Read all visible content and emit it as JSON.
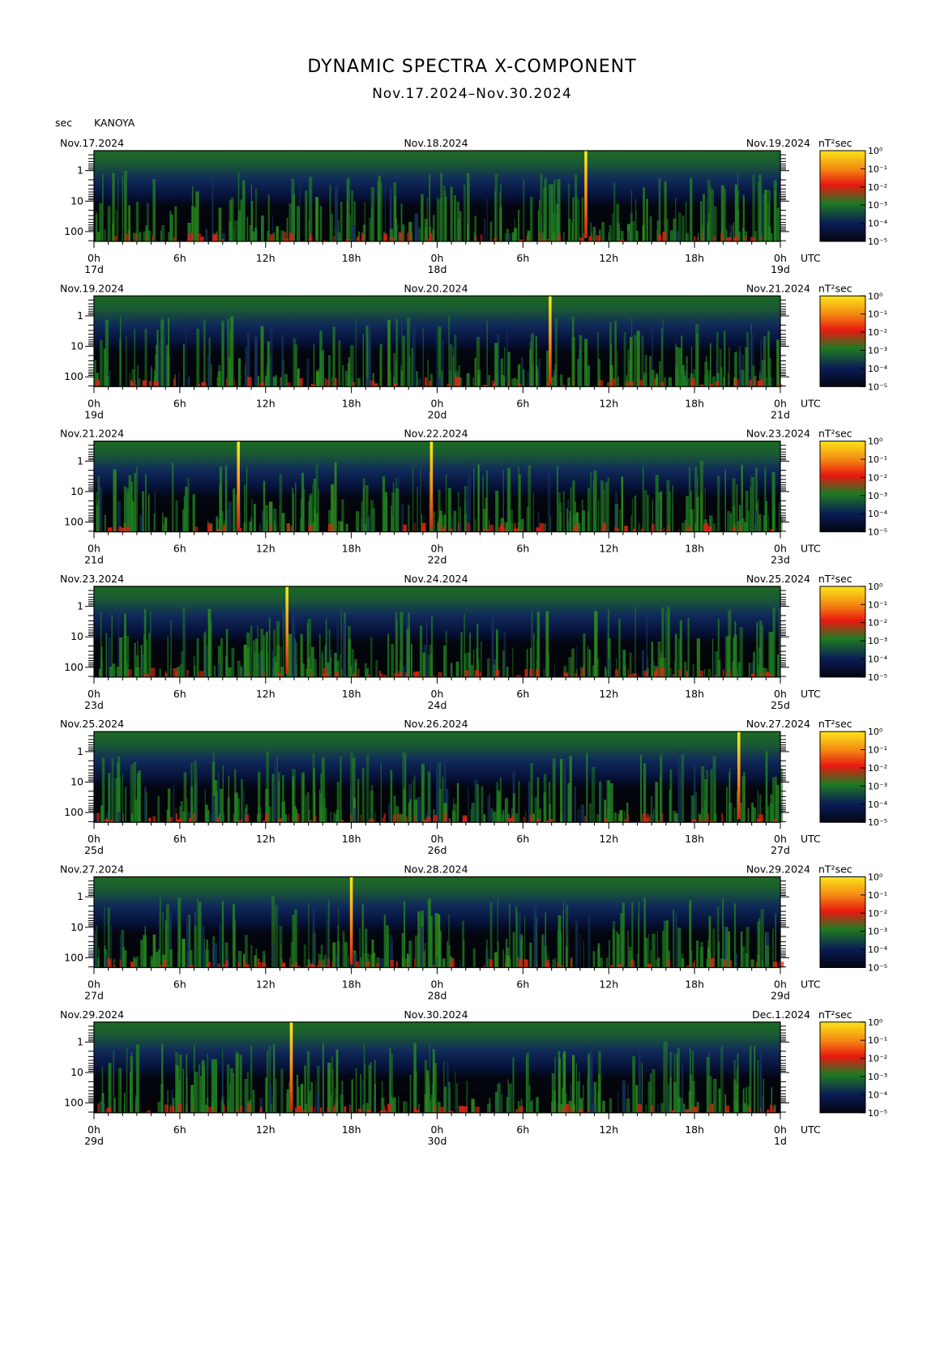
{
  "header": {
    "title": "DYNAMIC SPECTRA X-COMPONENT",
    "subtitle": "Nov.17.2024–Nov.30.2024",
    "unit_left": "sec",
    "station": "KANOYA"
  },
  "chart_data": {
    "type": "heatmap",
    "ylabel": "sec",
    "y_scale": "log",
    "y_tick_labels": [
      "1",
      "10",
      "100"
    ],
    "x_tick_labels": [
      "0h",
      "6h",
      "12h",
      "18h",
      "0h",
      "6h",
      "12h",
      "18h",
      "0h"
    ],
    "x_unit": "UTC",
    "colorbar_unit": "nT²sec",
    "colorbar_ticks": [
      "10⁰",
      "10⁻¹",
      "10⁻²",
      "10⁻³",
      "10⁻⁴",
      "10⁻⁵"
    ],
    "colormap": [
      "#050510",
      "#0a1c56",
      "#1e7a22",
      "#e81810",
      "#fbe51a"
    ],
    "panels": [
      {
        "date_left": "Nov.17.2024",
        "date_mid": "Nov.18.2024",
        "date_right": "Nov.19.2024",
        "day_left": "17d",
        "day_mid": "18d",
        "day_right": "19d",
        "spikes_hours": [
          34.4
        ]
      },
      {
        "date_left": "Nov.19.2024",
        "date_mid": "Nov.20.2024",
        "date_right": "Nov.21.2024",
        "day_left": "19d",
        "day_mid": "20d",
        "day_right": "21d",
        "spikes_hours": [
          31.9
        ]
      },
      {
        "date_left": "Nov.21.2024",
        "date_mid": "Nov.22.2024",
        "date_right": "Nov.23.2024",
        "day_left": "21d",
        "day_mid": "22d",
        "day_right": "23d",
        "spikes_hours": [
          10.1,
          23.6
        ]
      },
      {
        "date_left": "Nov.23.2024",
        "date_mid": "Nov.24.2024",
        "date_right": "Nov.25.2024",
        "day_left": "23d",
        "day_mid": "24d",
        "day_right": "25d",
        "spikes_hours": [
          13.5
        ]
      },
      {
        "date_left": "Nov.25.2024",
        "date_mid": "Nov.26.2024",
        "date_right": "Nov.27.2024",
        "day_left": "25d",
        "day_mid": "26d",
        "day_right": "27d",
        "spikes_hours": [
          45.1
        ]
      },
      {
        "date_left": "Nov.27.2024",
        "date_mid": "Nov.28.2024",
        "date_right": "Nov.29.2024",
        "day_left": "27d",
        "day_mid": "28d",
        "day_right": "29d",
        "spikes_hours": [
          18.0
        ]
      },
      {
        "date_left": "Nov.29.2024",
        "date_mid": "Nov.30.2024",
        "date_right": "Dec.1.2024",
        "day_left": "29d",
        "day_mid": "30d",
        "day_right": "1d",
        "spikes_hours": [
          13.8
        ]
      }
    ]
  }
}
